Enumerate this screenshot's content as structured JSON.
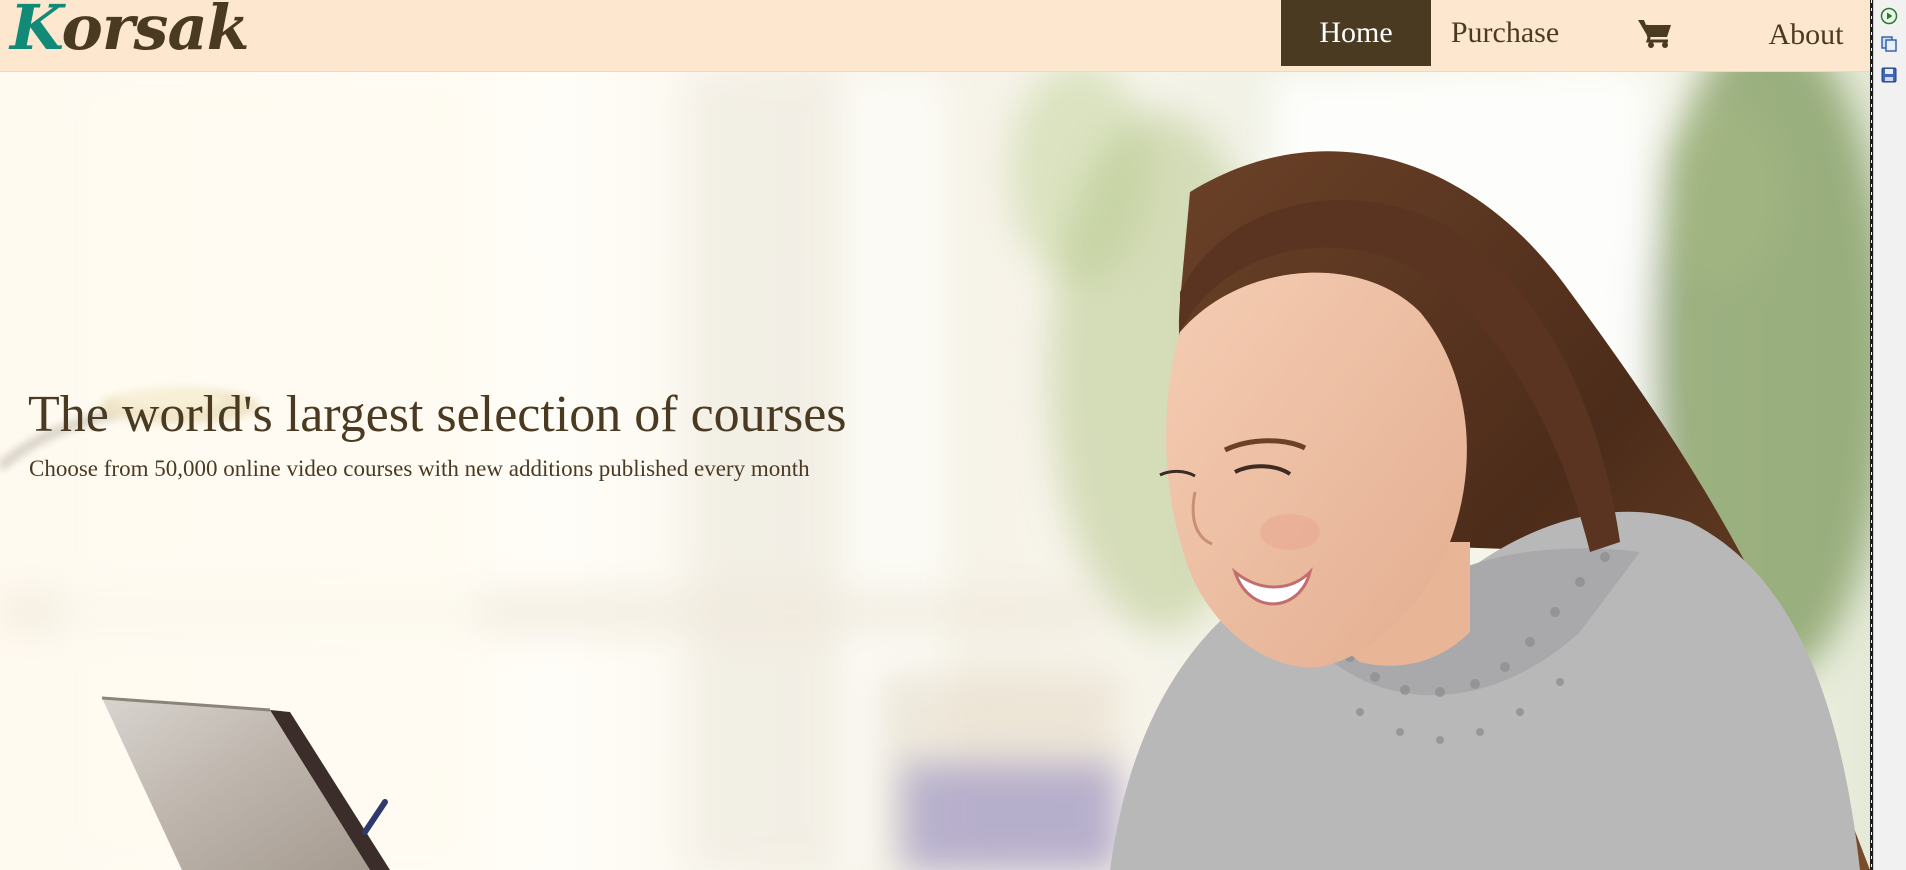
{
  "brand": {
    "logo_initial": "K",
    "logo_rest": "orsak",
    "initial_color": "#128a78",
    "text_color": "#4a3a22"
  },
  "nav": {
    "home": "Home",
    "purchase": "Purchase",
    "cart_icon": "shopping-cart-icon",
    "about": "About",
    "active": "Home",
    "bar_color": "#fde7cf",
    "active_color": "#4a3a22"
  },
  "hero": {
    "title": "The world's largest selection of courses",
    "subtitle": "Choose from 50,000 online video courses with new additions published every month",
    "image": "woman-smiling-at-laptop-photo"
  },
  "side_toolbar": {
    "icons": [
      "play-icon",
      "copy-icon",
      "save-icon"
    ]
  }
}
